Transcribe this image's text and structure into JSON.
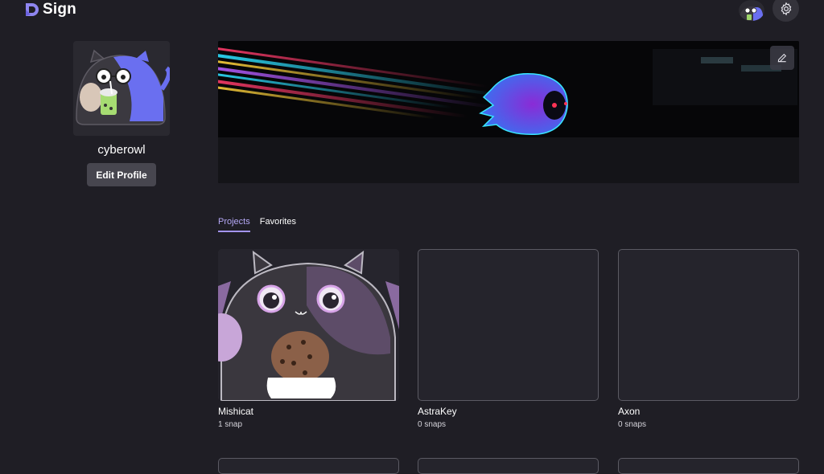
{
  "app": {
    "logo_text": "Sign"
  },
  "header": {
    "avatar_icon": "user-avatar-icon",
    "settings_icon": "gear-icon"
  },
  "profile": {
    "username": "cyberowl",
    "edit_label": "Edit Profile"
  },
  "banner": {
    "edit_icon": "pencil-icon"
  },
  "tabs": [
    {
      "label": "Projects",
      "active": true
    },
    {
      "label": "Favorites",
      "active": false
    }
  ],
  "projects": [
    {
      "name": "Mishicat",
      "snaps": "1 snap"
    },
    {
      "name": "AstraKey",
      "snaps": "0 snaps"
    },
    {
      "name": "Axon",
      "snaps": "0 snaps"
    }
  ],
  "colors": {
    "background": "#1f1e25",
    "accent": "#a394f0",
    "button": "#47464f"
  }
}
